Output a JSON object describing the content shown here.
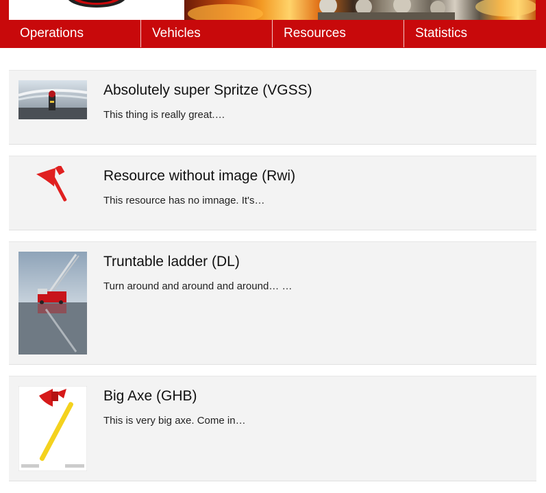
{
  "nav": {
    "items": [
      {
        "label": "Operations"
      },
      {
        "label": "Vehicles"
      },
      {
        "label": "Resources"
      },
      {
        "label": "Statistics"
      }
    ]
  },
  "resources": [
    {
      "title": "Absolutely super Spritze (VGSS)",
      "description": "This thing is really great.…",
      "image": "firefighter-water-photo"
    },
    {
      "title": "Resource without image (Rwi)",
      "description": "This resource has no imnage. It's…",
      "image": "axe-icon"
    },
    {
      "title": "Truntable ladder (DL)",
      "description": "Turn around and around and around… …",
      "image": "ladder-truck-photo"
    },
    {
      "title": "Big Axe (GHB)",
      "description": "This is very big axe. Come in…",
      "image": "fire-axe-photo"
    }
  ],
  "colors": {
    "brand": "#c8090b",
    "card_bg": "#f3f3f3"
  }
}
